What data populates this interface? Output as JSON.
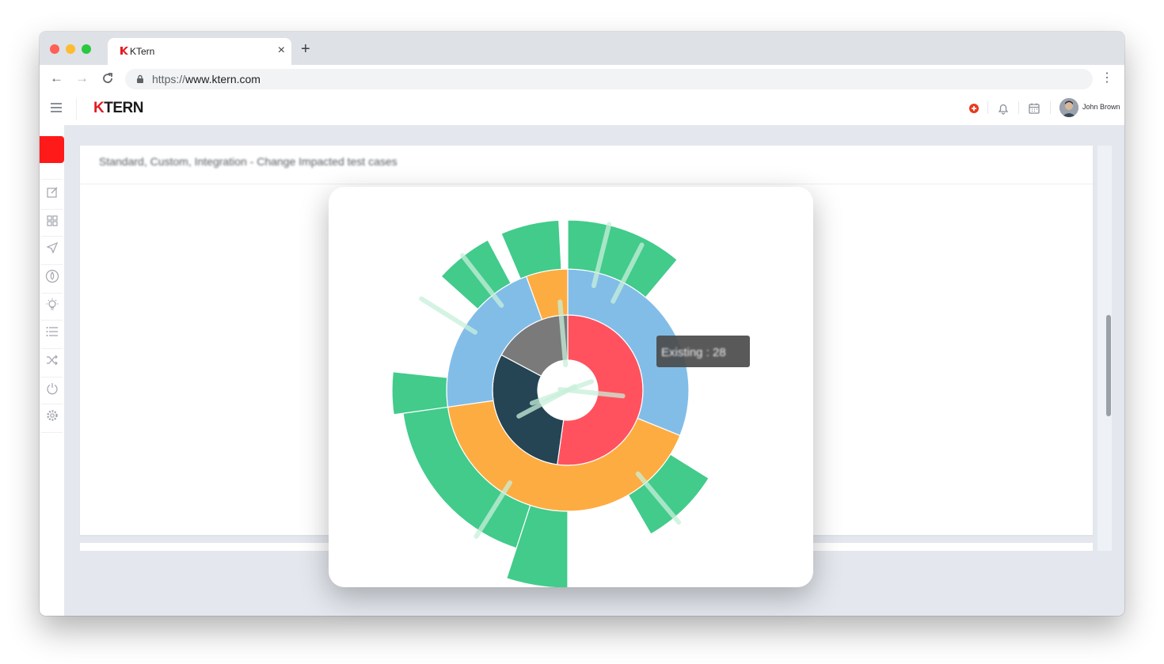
{
  "browser": {
    "tab_title": "KTern",
    "new_tab": "+",
    "close_tab": "×",
    "url_scheme": "https://",
    "url_host": "www.ktern.com",
    "nav_back": "←",
    "nav_forward": "→",
    "nav_reload": "C",
    "menu": "⋮"
  },
  "app": {
    "logo_k": "K",
    "logo_rest": "TERN",
    "user_name": "John Brown",
    "header_icons": [
      "add-circle-icon",
      "bell-icon",
      "calendar-icon"
    ],
    "sidebar_icons": [
      "edit-icon",
      "grid-icon",
      "send-icon",
      "drop-icon",
      "bulb-icon",
      "list-icon",
      "shuffle-icon",
      "power-icon",
      "settings-icon"
    ]
  },
  "card": {
    "title": "Standard, Custom, Integration - Change Impacted test cases"
  },
  "chart_data": {
    "type": "sunburst",
    "tooltip": "Existing : 28",
    "colors": {
      "inner_red": "#ff525e",
      "inner_navy": "#254454",
      "inner_gray": "#7a7a7a",
      "blue": "#82bde8",
      "orange": "#fdac42",
      "green": "#42cb8b"
    }
  }
}
